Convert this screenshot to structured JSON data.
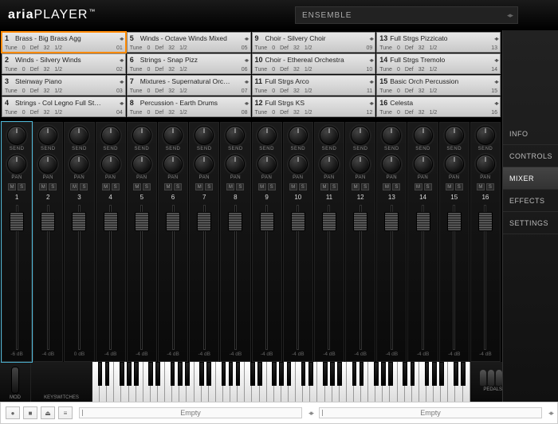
{
  "header": {
    "logo_bold": "aria",
    "logo_light": "PLAYER",
    "logo_tm": "™",
    "preset_label": "ENSEMBLE",
    "preset_arrows": "◂▸"
  },
  "side_tabs": [
    {
      "label": "INFO",
      "active": false
    },
    {
      "label": "CONTROLS",
      "active": false
    },
    {
      "label": "MIXER",
      "active": true
    },
    {
      "label": "EFFECTS",
      "active": false
    },
    {
      "label": "SETTINGS",
      "active": false
    }
  ],
  "slot_labels": {
    "tune": "Tune",
    "def": "Def",
    "v1": "0",
    "v2": "32",
    "v3": "1/2"
  },
  "slot_arrows": "◂▸",
  "slots": [
    {
      "n": 1,
      "name": "Brass - Big Brass Agg",
      "ch": "01",
      "hl": true
    },
    {
      "n": 5,
      "name": "Winds - Octave Winds Mixed",
      "ch": "05"
    },
    {
      "n": 9,
      "name": "Choir - Silvery Choir",
      "ch": "09"
    },
    {
      "n": 13,
      "name": "Full Strgs Pizzicato",
      "ch": "13"
    },
    {
      "n": 2,
      "name": "Winds - Silvery Winds",
      "ch": "02"
    },
    {
      "n": 6,
      "name": "Strings - Snap Pizz",
      "ch": "06"
    },
    {
      "n": 10,
      "name": "Choir - Ethereal Orchestra",
      "ch": "10"
    },
    {
      "n": 14,
      "name": "Full Strgs Tremolo",
      "ch": "14"
    },
    {
      "n": 3,
      "name": "Steinway Piano",
      "ch": "03"
    },
    {
      "n": 7,
      "name": "Mixtures - Supernatural Orc…",
      "ch": "07"
    },
    {
      "n": 11,
      "name": "Full Strgs Arco",
      "ch": "11"
    },
    {
      "n": 15,
      "name": "Basic Orch Percussion",
      "ch": "15"
    },
    {
      "n": 4,
      "name": "Strings - Col Legno Full St…",
      "ch": "04"
    },
    {
      "n": 8,
      "name": "Percussion - Earth Drums",
      "ch": "08"
    },
    {
      "n": 12,
      "name": "Full Strgs KS",
      "ch": "12"
    },
    {
      "n": 16,
      "name": "Celesta",
      "ch": "16"
    }
  ],
  "mixer": {
    "send_label": "SEND",
    "pan_label": "PAN",
    "mute_label": "M",
    "solo_label": "S",
    "channels": [
      {
        "n": 1,
        "db": "-6 dB",
        "hl": true,
        "sel": true
      },
      {
        "n": 2,
        "db": "-4 dB"
      },
      {
        "n": 3,
        "db": "0 dB"
      },
      {
        "n": 4,
        "db": "-4 dB"
      },
      {
        "n": 5,
        "db": "-4 dB"
      },
      {
        "n": 6,
        "db": "-4 dB"
      },
      {
        "n": 7,
        "db": "-4 dB"
      },
      {
        "n": 8,
        "db": "-4 dB"
      },
      {
        "n": 9,
        "db": "-4 dB"
      },
      {
        "n": 10,
        "db": "-4 dB"
      },
      {
        "n": 11,
        "db": "-4 dB"
      },
      {
        "n": 12,
        "db": "-4 dB"
      },
      {
        "n": 13,
        "db": "-4 dB"
      },
      {
        "n": 14,
        "db": "-4 dB"
      },
      {
        "n": 15,
        "db": "-4 dB"
      },
      {
        "n": 16,
        "db": "-4 dB"
      }
    ]
  },
  "bottom": {
    "mod_label": "MOD",
    "keyswitches_label": "KEYSWITCHES",
    "pedals_label": "PEDALS"
  },
  "transport": {
    "rec": "●",
    "stop": "■",
    "eject": "⏏",
    "menu": "≡",
    "empty": "Empty",
    "arrows": "◂▸"
  }
}
